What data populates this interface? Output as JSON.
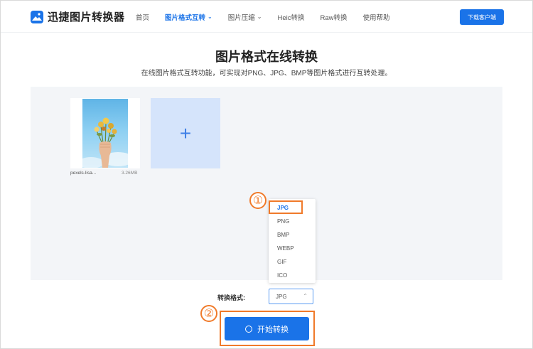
{
  "header": {
    "logo_text": "迅捷图片转换器",
    "nav": [
      {
        "label": "首页",
        "has_chevron": false,
        "active": false
      },
      {
        "label": "图片格式互转",
        "has_chevron": true,
        "active": true
      },
      {
        "label": "图片压缩",
        "has_chevron": true,
        "active": false
      },
      {
        "label": "Heic转换",
        "has_chevron": false,
        "active": false
      },
      {
        "label": "Raw转换",
        "has_chevron": false,
        "active": false
      },
      {
        "label": "使用帮助",
        "has_chevron": false,
        "active": false
      }
    ],
    "download_button": "下载客户端"
  },
  "main": {
    "title": "图片格式在线转换",
    "subtitle": "在线图片格式互转功能，可实现对PNG、JPG、BMP等图片格式进行互转处理。"
  },
  "file": {
    "name": "pexels-lisa...",
    "size": "3.26MB"
  },
  "add_icon": "+",
  "dropdown": {
    "options": [
      "JPG",
      "PNG",
      "BMP",
      "WEBP",
      "GIF",
      "ICO"
    ],
    "selected": "JPG"
  },
  "format": {
    "label": "转换格式:",
    "value": "JPG",
    "chevron_icon": "chevron-up-icon"
  },
  "start_button": "开始转换",
  "annotations": {
    "step1": "①",
    "step2": "②",
    "highlight_color": "#f07a2a"
  },
  "colors": {
    "accent": "#1a73e8",
    "work_area_bg": "#f3f5f8",
    "add_box_bg": "#d5e4fb"
  }
}
